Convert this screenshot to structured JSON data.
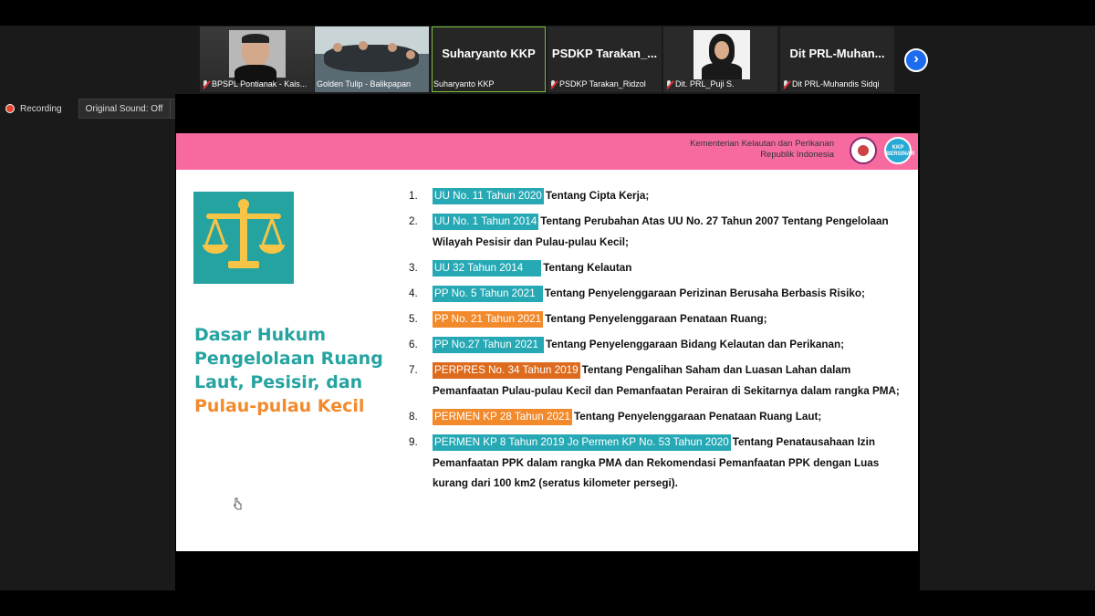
{
  "participants": [
    {
      "name": "BPSPL Pontianak - Kais...",
      "type": "video",
      "muted": true
    },
    {
      "name": "Golden Tulip - Balikpapan",
      "type": "video",
      "muted": false
    },
    {
      "name": "Suharyanto KKP",
      "display": "Suharyanto KKP",
      "type": "name",
      "muted": false,
      "active": true
    },
    {
      "name": "PSDKP Tarakan_Ridzol",
      "display": "PSDKP  Tarakan_...",
      "type": "name",
      "muted": true
    },
    {
      "name": "Dit. PRL_Puji S.",
      "type": "video",
      "muted": true
    },
    {
      "name": "Dit PRL-Muhandis Sidqi",
      "display": "Dit  PRL-Muhan...",
      "type": "name",
      "muted": true
    }
  ],
  "recording": {
    "label": "Recording"
  },
  "original_sound": {
    "label": "Original Sound: Off"
  },
  "slide": {
    "ministry_line1": "Kementerian Kelautan dan Perikanan",
    "ministry_line2": "Republik Indonesia",
    "logo2_text": "KKP BERSINAR",
    "title_line1": "Dasar Hukum",
    "title_line2": "Pengelolaan Ruang",
    "title_line3": "Laut, Pesisir, dan",
    "title_line4": "Pulau-pulau Kecil",
    "items": [
      {
        "num": "1.",
        "tag": "UU No. 11 Tahun 2020",
        "text": "Tentang Cipta Kerja;",
        "color": "teal"
      },
      {
        "num": "2.",
        "tag": "UU No. 1 Tahun 2014",
        "text": "Tentang Perubahan Atas UU No. 27 Tahun 2007 Tentang Pengelolaan Wilayah Pesisir dan Pulau-pulau Kecil;",
        "color": "teal"
      },
      {
        "num": "3.",
        "tag": "UU 32 Tahun 2014",
        "text": "Tentang Kelautan",
        "color": "teal"
      },
      {
        "num": "4.",
        "tag": "PP No. 5 Tahun 2021",
        "text": "Tentang Penyelenggaraan Perizinan Berusaha Berbasis Risiko;",
        "color": "teal"
      },
      {
        "num": "5.",
        "tag": "PP No. 21 Tahun 2021",
        "text": "Tentang Penyelenggaraan Penataan Ruang;",
        "color": "orange"
      },
      {
        "num": "6.",
        "tag": "PP No.27 Tahun 2021",
        "text": "Tentang Penyelenggaraan Bidang Kelautan dan Perikanan;",
        "color": "teal"
      },
      {
        "num": "7.",
        "tag": "PERPRES No. 34 Tahun 2019",
        "text": "Tentang Pengalihan Saham dan Luasan Lahan dalam Pemanfaatan Pulau-pulau Kecil dan Pemanfaatan Perairan di Sekitarnya dalam rangka PMA;",
        "color": "dkorange"
      },
      {
        "num": "8.",
        "tag": "PERMEN KP 28 Tahun 2021",
        "text": "Tentang Penyelenggaraan Penataan Ruang Laut;",
        "color": "orange"
      },
      {
        "num": "9.",
        "tag": "PERMEN KP 8 Tahun 2019  Jo Permen KP No. 53 Tahun 2020",
        "text": "Tentang Penatausahaan Izin Pemanfaatan PPK dalam rangka PMA dan Rekomendasi Pemanfaatan PPK dengan Luas kurang dari 100 km2 (seratus kilometer persegi).",
        "color": "teal"
      }
    ]
  },
  "icons": [
    "microphone-muted-icon",
    "chevron-right-icon",
    "record-icon",
    "caret-down-icon",
    "scales-of-justice-icon",
    "cursor-icon"
  ]
}
